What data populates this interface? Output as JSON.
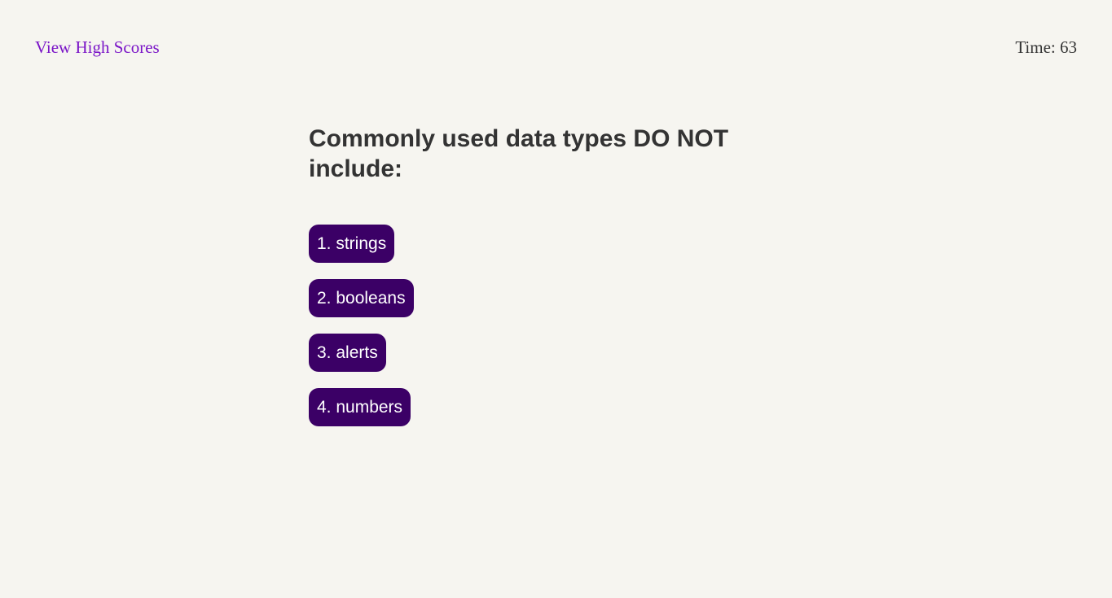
{
  "header": {
    "high_scores_link": "View High Scores",
    "timer_label": "Time: 63"
  },
  "quiz": {
    "question": "Commonly used data types DO NOT include:",
    "choices": [
      {
        "label": "1. strings"
      },
      {
        "label": "2. booleans"
      },
      {
        "label": "3. alerts"
      },
      {
        "label": "4. numbers"
      }
    ]
  },
  "colors": {
    "background": "#f6f5f0",
    "link": "#7a14c7",
    "text": "#333333",
    "button": "#3b0066",
    "button_text": "#ffffff"
  }
}
